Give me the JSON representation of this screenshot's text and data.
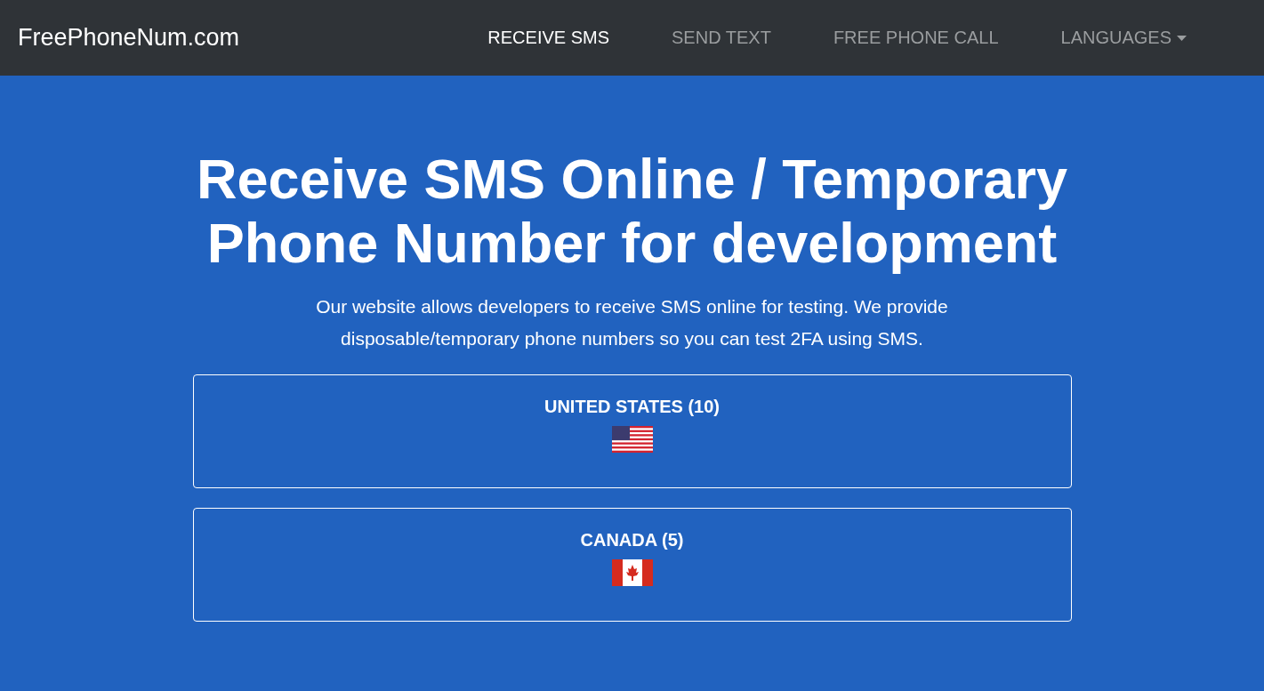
{
  "navbar": {
    "brand": "FreePhoneNum.com",
    "links": [
      {
        "label": "RECEIVE SMS",
        "selected": true,
        "dropdown": false
      },
      {
        "label": "SEND TEXT",
        "selected": false,
        "dropdown": false
      },
      {
        "label": "FREE PHONE CALL",
        "selected": false,
        "dropdown": false
      },
      {
        "label": "LANGUAGES",
        "selected": false,
        "dropdown": true
      }
    ]
  },
  "hero": {
    "title": "Receive SMS Online / Temporary Phone Number for development",
    "description": "Our website allows developers to receive SMS online for testing. We provide disposable/temporary phone numbers so you can test 2FA using SMS."
  },
  "countries": [
    {
      "name": "UNITED STATES (10)",
      "kind": "us"
    },
    {
      "name": "CANADA (5)",
      "kind": "ca"
    }
  ]
}
